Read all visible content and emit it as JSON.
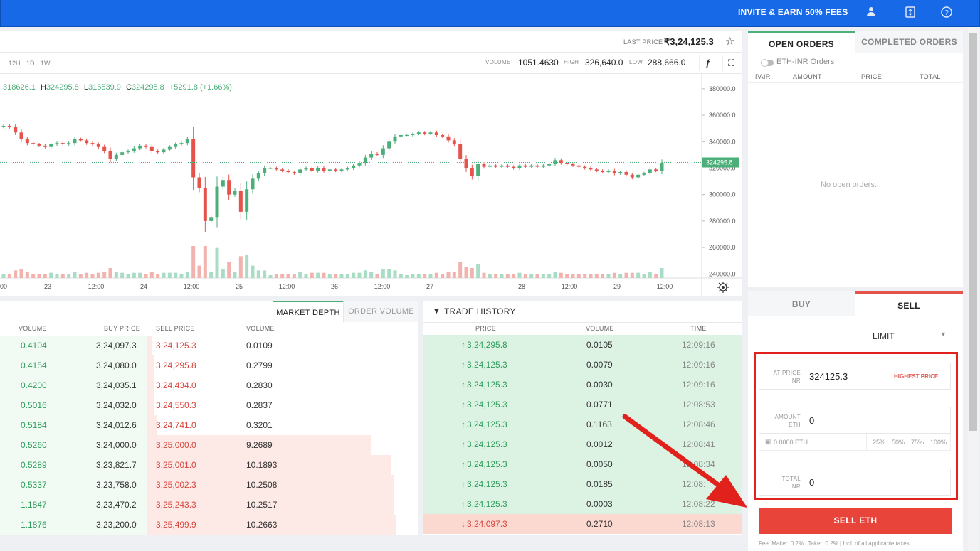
{
  "topbar": {
    "invite": "INVITE & EARN 50% FEES",
    "icons": [
      "user-icon",
      "wallet-icon",
      "help-icon"
    ]
  },
  "header": {
    "last_price_label": "LAST PRICE",
    "last_price": "₹3,24,125.3"
  },
  "toolbar": {
    "intervals": [
      "12H",
      "1D",
      "1W"
    ],
    "volume_label": "VOLUME",
    "volume": "1051.4630",
    "high_label": "HIGH",
    "high": "326,640.0",
    "low_label": "LOW",
    "low": "288,666.0"
  },
  "ohlc": {
    "o": "318626.1",
    "h_prefix": "H",
    "h": "324295.8",
    "l_prefix": "L",
    "l": "315539.9",
    "c_prefix": "C",
    "c": "324295.8",
    "change": "+5291.8 (+1.66%)"
  },
  "chart_data": {
    "type": "candlestick",
    "y_ticks": [
      "380000.0",
      "360000.0",
      "340000.0",
      "320000.0",
      "300000.0",
      "280000.0",
      "260000.0",
      "240000.0"
    ],
    "ylim": [
      238000,
      388000
    ],
    "x_ticks": [
      "00",
      "23",
      "12:00",
      "24",
      "12:00",
      "25",
      "12:00",
      "26",
      "12:00",
      "27",
      "28",
      "12:00",
      "29",
      "12:00"
    ],
    "current_price_tag": "324295.8",
    "closes": [
      352000,
      351000,
      347000,
      342000,
      339000,
      338000,
      337000,
      336000,
      338000,
      339000,
      338000,
      339000,
      342000,
      341000,
      339000,
      338000,
      336000,
      333000,
      327000,
      330000,
      332000,
      333000,
      335000,
      337000,
      336000,
      333000,
      332000,
      334000,
      336000,
      338000,
      339000,
      342000,
      313000,
      305000,
      280000,
      283000,
      306000,
      311000,
      300000,
      303000,
      287000,
      304000,
      312000,
      316000,
      320000,
      320000,
      319000,
      318000,
      317000,
      316000,
      319000,
      320000,
      318000,
      320000,
      318000,
      319000,
      318000,
      319000,
      320000,
      322000,
      324000,
      328000,
      331000,
      330000,
      335000,
      340000,
      344000,
      345000,
      345000,
      346000,
      347000,
      346000,
      347000,
      345000,
      344000,
      341000,
      338000,
      327000,
      320000,
      314000,
      323000,
      321000,
      322000,
      321000,
      322000,
      321000,
      320000,
      322000,
      321000,
      322000,
      321000,
      322000,
      323000,
      326000,
      324000,
      323000,
      322000,
      321000,
      320000,
      319000,
      318000,
      317000,
      318000,
      316000,
      317000,
      315000,
      313000,
      315000,
      316000,
      319000,
      318000,
      324000
    ]
  },
  "order_book": {
    "tabs": [
      "MARKET DEPTH",
      "ORDER VOLUME"
    ],
    "headers": [
      "VOLUME",
      "BUY PRICE",
      "SELL PRICE",
      "VOLUME"
    ],
    "rows": [
      {
        "bv": "0.4104",
        "bp": "3,24,097.3",
        "sp": "3,24,125.3",
        "sv": "0.0109",
        "depth": 0.0
      },
      {
        "bv": "0.4154",
        "bp": "3,24,080.0",
        "sp": "3,24,295.8",
        "sv": "0.2799",
        "depth": 0.03
      },
      {
        "bv": "0.4200",
        "bp": "3,24,035.1",
        "sp": "3,24,434.0",
        "sv": "0.2830",
        "depth": 0.03
      },
      {
        "bv": "0.5016",
        "bp": "3,24,032.0",
        "sp": "3,24,550.3",
        "sv": "0.2837",
        "depth": 0.03
      },
      {
        "bv": "0.5184",
        "bp": "3,24,012.6",
        "sp": "3,24,741.0",
        "sv": "0.3201",
        "depth": 0.04
      },
      {
        "bv": "0.5260",
        "bp": "3,24,000.0",
        "sp": "3,25,000.0",
        "sv": "9.2689",
        "depth": 0.87
      },
      {
        "bv": "0.5289",
        "bp": "3,23,821.7",
        "sp": "3,25,001.0",
        "sv": "10.1893",
        "depth": 0.95
      },
      {
        "bv": "0.5337",
        "bp": "3,23,758.0",
        "sp": "3,25,002.3",
        "sv": "10.2508",
        "depth": 0.96
      },
      {
        "bv": "1.1847",
        "bp": "3,23,470.2",
        "sp": "3,25,243.3",
        "sv": "10.2517",
        "depth": 0.96
      },
      {
        "bv": "1.1876",
        "bp": "3,23,200.0",
        "sp": "3,25,499.9",
        "sv": "10.2663",
        "depth": 0.97
      }
    ]
  },
  "trade_history": {
    "title": "TRADE HISTORY",
    "headers": [
      "PRICE",
      "VOLUME",
      "TIME"
    ],
    "rows": [
      {
        "dir": "↑",
        "price": "3,24,295.8",
        "vol": "0.0105",
        "time": "12:09:16",
        "side": "buy"
      },
      {
        "dir": "↑",
        "price": "3,24,125.3",
        "vol": "0.0079",
        "time": "12:09:16",
        "side": "buy"
      },
      {
        "dir": "↑",
        "price": "3,24,125.3",
        "vol": "0.0030",
        "time": "12:09:16",
        "side": "buy"
      },
      {
        "dir": "↑",
        "price": "3,24,125.3",
        "vol": "0.0771",
        "time": "12:08:53",
        "side": "buy"
      },
      {
        "dir": "↑",
        "price": "3,24,125.3",
        "vol": "0.1163",
        "time": "12:08:46",
        "side": "buy"
      },
      {
        "dir": "↑",
        "price": "3,24,125.3",
        "vol": "0.0012",
        "time": "12:08:41",
        "side": "buy"
      },
      {
        "dir": "↑",
        "price": "3,24,125.3",
        "vol": "0.0050",
        "time": "12:08:34",
        "side": "buy"
      },
      {
        "dir": "↑",
        "price": "3,24,125.3",
        "vol": "0.0185",
        "time": "12:08:",
        "side": "buy"
      },
      {
        "dir": "↑",
        "price": "3,24,125.3",
        "vol": "0.0003",
        "time": "12:08:22",
        "side": "buy"
      },
      {
        "dir": "↓",
        "price": "3,24,097.3",
        "vol": "0.2710",
        "time": "12:08:13",
        "side": "sell"
      }
    ]
  },
  "orders": {
    "tabs": [
      "OPEN ORDERS",
      "COMPLETED ORDERS"
    ],
    "toggle_label": "ETH-INR Orders",
    "headers": [
      "PAIR",
      "AMOUNT",
      "PRICE",
      "TOTAL"
    ],
    "empty": "No open orders..."
  },
  "trade": {
    "tabs": [
      "BUY",
      "SELL"
    ],
    "order_type": "LIMIT",
    "price_label_1": "AT PRICE",
    "price_label_2": "INR",
    "price_value": "324125.3",
    "highest_price": "HIGHEST PRICE",
    "amount_label_1": "AMOUNT",
    "amount_label_2": "ETH",
    "amount_value": "0",
    "balance": "0.0000 ETH",
    "percents": [
      "25%",
      "50%",
      "75%",
      "100%"
    ],
    "total_label_1": "TOTAL",
    "total_label_2": "INR",
    "total_value": "0",
    "submit": "SELL ETH",
    "fee": "Fee: Maker: 0.2% | Taker: 0.2% | Incl. of all applicable taxes"
  },
  "colors": {
    "accent": "#1769e8",
    "buy": "#4caf7a",
    "sell": "#e5534b",
    "annotation": "#e0211c"
  }
}
